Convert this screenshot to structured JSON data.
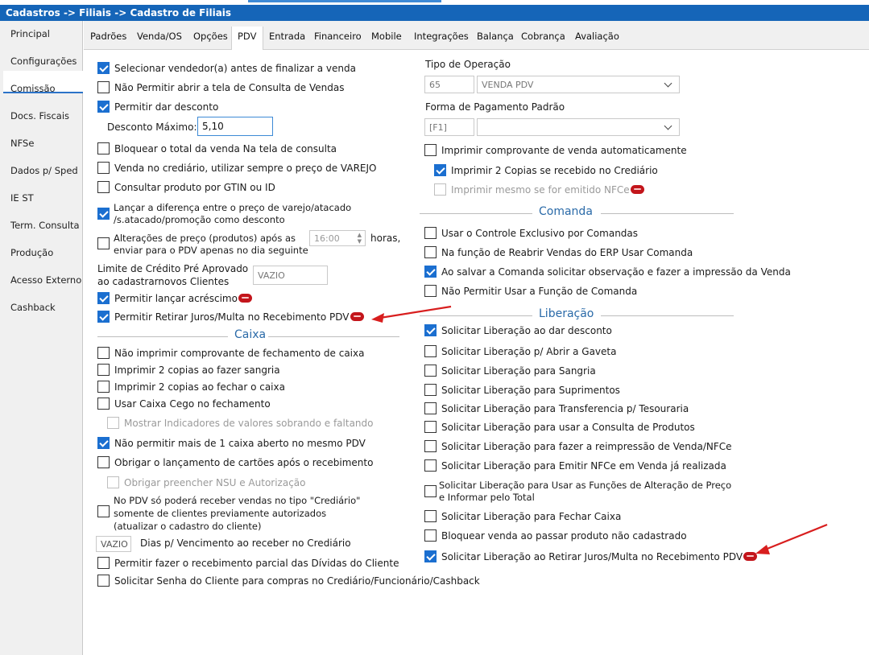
{
  "title": "Cadastros -> Filiais -> Cadastro de Filiais",
  "sidebar": [
    "Principal",
    "Configurações",
    "Comissão",
    "Docs. Fiscais",
    "NFSe",
    "Dados p/ Sped",
    "IE ST",
    "Term. Consulta",
    "Produção",
    "Acesso Externo",
    "Cashback"
  ],
  "tabs": [
    "Padrões",
    "Venda/OS",
    "Opções",
    "PDV",
    "Entrada",
    "Financeiro",
    "Mobile",
    "Integrações",
    "Balança",
    "Cobrança",
    "Avaliação"
  ],
  "left": {
    "c0": "Selecionar vendedor(a) antes de finalizar a venda",
    "c1": "Não Permitir abrir a tela de Consulta de Vendas",
    "c2": "Permitir dar desconto",
    "desconto_label": "Desconto Máximo:",
    "desconto_value": "5,10",
    "c3": "Bloquear o total da venda Na tela de consulta",
    "c4": "Venda no crediário, utilizar sempre o preço de VAREJO",
    "c5": "Consultar produto por GTIN ou ID",
    "c6a": "Lançar a diferença entre o preço de varejo/atacado",
    "c6b": "/s.atacado/promoção como desconto",
    "c7a": "Alterações de preço (produtos) após as",
    "c7b": "enviar para o PDV apenas no dia seguinte",
    "c7_time": "16:00",
    "c7_unit": "horas,",
    "limite_a": "Limite de Crédito Pré Aprovado",
    "limite_b": "ao cadastrarnovos Clientes",
    "limite_value": "VAZIO",
    "c8": "Permitir lançar acréscimo",
    "c9": "Permitir Retirar Juros/Multa no Recebimento PDV",
    "caixa_title": "Caixa",
    "k0": "Não imprimir comprovante de fechamento de caixa",
    "k1": "Imprimir 2 copias ao fazer sangria",
    "k2": "Imprimir 2 copias ao fechar o caixa",
    "k3": "Usar Caixa Cego no fechamento",
    "k4": "Mostrar Indicadores de valores sobrando e faltando",
    "k5": "Não permitir mais de 1 caixa aberto no mesmo PDV",
    "k6": "Obrigar o lançamento de cartões após o recebimento",
    "k7": "Obrigar preencher NSU e Autorização",
    "k8a": "No PDV só poderá receber vendas no tipo \"Crediário\"",
    "k8b": "somente de clientes previamente autorizados",
    "k8c": "(atualizar o cadastro do cliente)",
    "dias_value": "VAZIO",
    "dias_label": "Dias p/ Vencimento ao receber no Crediário",
    "k9": "Permitir fazer o recebimento parcial das Dívidas do Cliente",
    "k10": "Solicitar Senha do Cliente para compras no Crediário/Funcionário/Cashback"
  },
  "right": {
    "tipo_label": "Tipo de Operação",
    "tipo_code": "65",
    "tipo_value": "VENDA PDV",
    "forma_label": "Forma de Pagamento Padrão",
    "forma_code": "[F1]",
    "forma_value": "",
    "r0": "Imprimir comprovante de venda automaticamente",
    "r1": "Imprimir 2 Copias se recebido no Crediário",
    "r2": "Imprimir mesmo se for emitido NFCe",
    "comanda_title": "Comanda",
    "m0": "Usar o Controle Exclusivo por Comandas",
    "m1": "Na função de Reabrir Vendas do ERP Usar Comanda",
    "m2": "Ao salvar a Comanda solicitar observação e fazer a impressão da Venda",
    "m3": "Não Permitir Usar a Função de Comanda",
    "lib_title": "Liberação",
    "l0": "Solicitar Liberação ao dar desconto",
    "l1": "Solicitar Liberação p/ Abrir a Gaveta",
    "l2": "Solicitar Liberação para Sangria",
    "l3": "Solicitar Liberação para Suprimentos",
    "l4": "Solicitar Liberação para Transferencia p/ Tesouraria",
    "l5": "Solicitar Liberação para usar a Consulta de Produtos",
    "l6": "Solicitar Liberação para fazer a reimpressão de Venda/NFCe",
    "l7": "Solicitar Liberação para Emitir NFCe em Venda já realizada",
    "l8a": "Solicitar Liberação para Usar as Funções de Alteração de Preço",
    "l8b": "e Informar pelo Total",
    "l9": "Solicitar Liberação para Fechar Caixa",
    "l10": "Bloquear venda ao passar produto não cadastrado",
    "l11": "Solicitar Liberação ao Retirar Juros/Multa no Recebimento PDV"
  },
  "colors": {
    "titlebar": "#1565b8",
    "accent": "#1b6fd0",
    "section": "#2a6aa8",
    "badge": "#c3151b",
    "arrow": "#d81e1e"
  }
}
